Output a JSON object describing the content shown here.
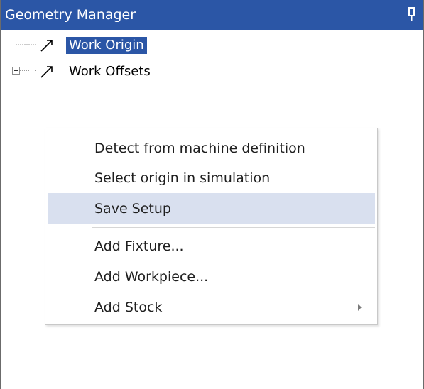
{
  "panel": {
    "title": "Geometry Manager",
    "pin_icon": "pin-icon",
    "accent_color": "#2b56a6"
  },
  "tree": {
    "items": [
      {
        "label": "Work Origin",
        "icon": "arrow-icon",
        "selected": true,
        "expandable": false
      },
      {
        "label": "Work Offsets",
        "icon": "arrow-icon",
        "selected": false,
        "expandable": true
      }
    ]
  },
  "context_menu": {
    "items": [
      {
        "label": "Detect from machine definition"
      },
      {
        "label": "Select origin in simulation"
      },
      {
        "label": "Save Setup",
        "highlighted": true
      },
      {
        "label": "Add Fixture..."
      },
      {
        "label": "Add Workpiece..."
      },
      {
        "label": "Add Stock",
        "has_submenu": true
      }
    ],
    "highlight_color": "#d9e0ef"
  }
}
